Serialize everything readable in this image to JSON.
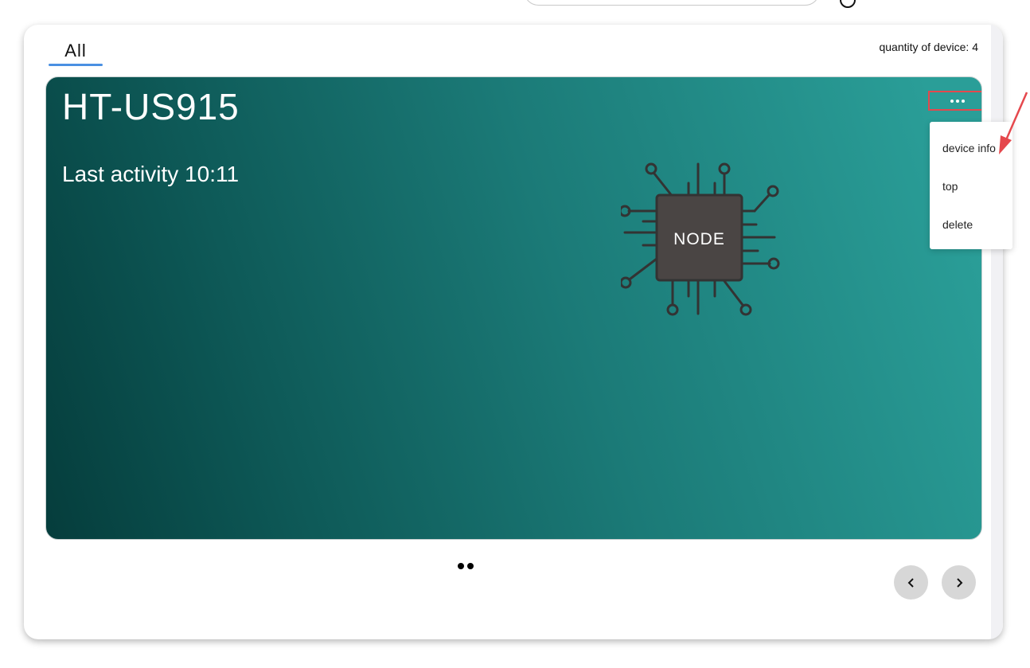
{
  "tabs": [
    {
      "label": "All",
      "active": true
    }
  ],
  "device_count_text": "quantity of device: 4",
  "card": {
    "title": "HT-US915",
    "activity": "Last activity 10:11",
    "chip_label": "NODE",
    "gradient_colors": [
      "#053d3c",
      "#2a9e98"
    ]
  },
  "more_button": {
    "icon": "more-horizontal-icon"
  },
  "menu": {
    "items": [
      {
        "label": "device info"
      },
      {
        "label": "top"
      },
      {
        "label": "delete"
      }
    ]
  },
  "pagination": {
    "pages": 2
  },
  "nav": {
    "prev_icon": "chevron-left-icon",
    "next_icon": "chevron-right-icon"
  },
  "colors": {
    "accent": "#4a90e2",
    "highlight": "#e5484d"
  }
}
